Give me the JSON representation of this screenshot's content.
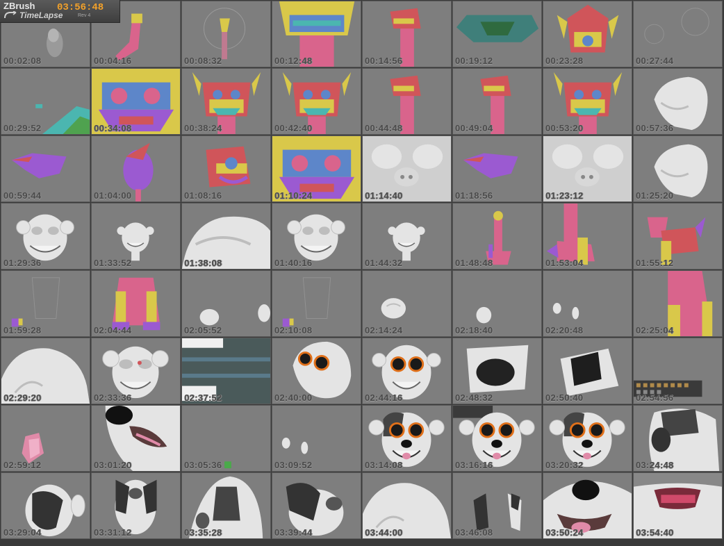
{
  "app": {
    "brand": "ZBrush",
    "product": "TimeLapse",
    "revision": "Rev 4",
    "total_time": "03:56:48"
  },
  "frames": [
    {
      "time": "00:02:08",
      "kind": "gray-nose"
    },
    {
      "time": "00:04:16",
      "kind": "pink-yellow-stub"
    },
    {
      "time": "00:08:32",
      "kind": "yellow-head-faint"
    },
    {
      "time": "00:12:48",
      "kind": "colored-head-close"
    },
    {
      "time": "00:14:56",
      "kind": "pink-neck-side"
    },
    {
      "time": "00:19:12",
      "kind": "teal-shape"
    },
    {
      "time": "00:23:28",
      "kind": "colored-head-front"
    },
    {
      "time": "00:27:44",
      "kind": "faint"
    },
    {
      "time": "00:29:52",
      "kind": "blue-green-corner"
    },
    {
      "time": "00:34:08",
      "kind": "colored-close-big"
    },
    {
      "time": "00:38:24",
      "kind": "colored-ears-front"
    },
    {
      "time": "00:42:40",
      "kind": "colored-ears-front"
    },
    {
      "time": "00:44:48",
      "kind": "pink-neck-side"
    },
    {
      "time": "00:49:04",
      "kind": "pink-neck-side"
    },
    {
      "time": "00:53:20",
      "kind": "colored-ears-front"
    },
    {
      "time": "00:57:36",
      "kind": "white-head-side"
    },
    {
      "time": "00:59:44",
      "kind": "purple-lips"
    },
    {
      "time": "01:04:00",
      "kind": "purple-blob"
    },
    {
      "time": "01:08:16",
      "kind": "colored-side"
    },
    {
      "time": "01:10:24",
      "kind": "colored-close-big"
    },
    {
      "time": "01:14:40",
      "kind": "white-face-close"
    },
    {
      "time": "01:18:56",
      "kind": "purple-lips"
    },
    {
      "time": "01:23:12",
      "kind": "white-face-close"
    },
    {
      "time": "01:25:20",
      "kind": "white-head-side"
    },
    {
      "time": "01:29:36",
      "kind": "white-head-front"
    },
    {
      "time": "01:33:52",
      "kind": "white-head-small"
    },
    {
      "time": "01:38:08",
      "kind": "white-close-angle"
    },
    {
      "time": "01:40:16",
      "kind": "white-head-front"
    },
    {
      "time": "01:44:32",
      "kind": "white-head-small"
    },
    {
      "time": "01:48:48",
      "kind": "pink-figure"
    },
    {
      "time": "01:53:04",
      "kind": "pink-figure-big"
    },
    {
      "time": "01:55:12",
      "kind": "pink-animal"
    },
    {
      "time": "01:59:28",
      "kind": "faint-legs"
    },
    {
      "time": "02:04:44",
      "kind": "pink-body-legs"
    },
    {
      "time": "02:05:52",
      "kind": "white-feet"
    },
    {
      "time": "02:10:08",
      "kind": "faint-legs"
    },
    {
      "time": "02:14:24",
      "kind": "white-paw"
    },
    {
      "time": "02:18:40",
      "kind": "white-paw-small"
    },
    {
      "time": "02:20:48",
      "kind": "white-paws-tiny"
    },
    {
      "time": "02:25:04",
      "kind": "pink-body-close"
    },
    {
      "time": "02:29:20",
      "kind": "white-body-close"
    },
    {
      "time": "02:33:36",
      "kind": "white-head-eyes"
    },
    {
      "time": "02:37:52",
      "kind": "ui-dialog"
    },
    {
      "time": "02:40:00",
      "kind": "orange-eyes-angle"
    },
    {
      "time": "02:44:16",
      "kind": "orange-eyes-front"
    },
    {
      "time": "02:48:32",
      "kind": "black-patch-flat"
    },
    {
      "time": "02:50:40",
      "kind": "black-patch-angle"
    },
    {
      "time": "02:54:56",
      "kind": "ui-toolbar"
    },
    {
      "time": "02:59:12",
      "kind": "pink-ear"
    },
    {
      "time": "03:01:20",
      "kind": "dog-side-mouth"
    },
    {
      "time": "03:05:36",
      "kind": "empty-gray"
    },
    {
      "time": "03:09:52",
      "kind": "white-paws-tiny"
    },
    {
      "time": "03:14:08",
      "kind": "dog-face"
    },
    {
      "time": "03:16:16",
      "kind": "dog-face-tools"
    },
    {
      "time": "03:20:32",
      "kind": "dog-face"
    },
    {
      "time": "03:24:48",
      "kind": "dog-side"
    },
    {
      "time": "03:29:04",
      "kind": "dog-back"
    },
    {
      "time": "03:31:12",
      "kind": "dog-back-front"
    },
    {
      "time": "03:35:28",
      "kind": "dog-close-top"
    },
    {
      "time": "03:39:44",
      "kind": "dog-body"
    },
    {
      "time": "03:44:00",
      "kind": "white-body-close"
    },
    {
      "time": "03:46:08",
      "kind": "dog-ears-pair"
    },
    {
      "time": "03:50:24",
      "kind": "dog-mouth-close"
    },
    {
      "time": "03:54:40",
      "kind": "dog-mouth-open"
    }
  ]
}
